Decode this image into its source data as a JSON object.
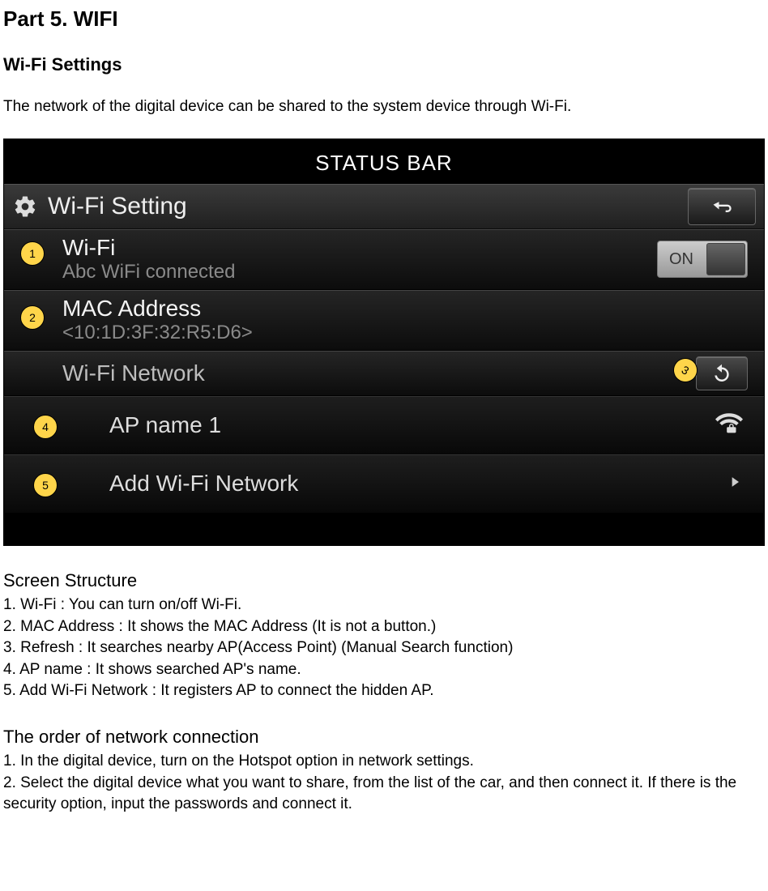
{
  "doc": {
    "part_title": "Part 5. WIFI",
    "section_title": "Wi-Fi Settings",
    "intro": "The network of the digital device can be shared to the system device through Wi-Fi."
  },
  "screenshot": {
    "status_bar": "STATUS BAR",
    "header_title": "Wi-Fi Setting",
    "wifi_row": {
      "title": "Wi-Fi",
      "sub": "Abc WiFi connected",
      "toggle_label": "ON"
    },
    "mac_row": {
      "title": "MAC Address",
      "sub": "<10:1D:3F:32:R5:D6>"
    },
    "network_row": {
      "title": "Wi-Fi Network"
    },
    "ap_item": {
      "label": "AP name 1"
    },
    "add_item": {
      "label": "Add Wi-Fi Network"
    },
    "callouts": {
      "c1": "1",
      "c2": "2",
      "c3": "3",
      "c4": "4",
      "c5": "5"
    }
  },
  "screen_structure": {
    "heading": "Screen Structure",
    "items": {
      "i1": "1. Wi-Fi : You can turn on/off Wi-Fi.",
      "i2": "2. MAC Address : It shows the MAC Address (It is not a button.)",
      "i3": "3. Refresh : It searches nearby AP(Access Point) (Manual Search function)",
      "i4": "4. AP name : It shows searched AP's name.",
      "i5": "5. Add Wi-Fi Network : It registers AP to connect the hidden AP."
    }
  },
  "order": {
    "heading": "The order of network connection",
    "items": {
      "o1": "1. In the digital device, turn on the Hotspot option in network settings.",
      "o2": "2. Select the digital device what you want to share, from the list of the car, and then connect it. If there is the security option, input the passwords and connect it."
    }
  }
}
